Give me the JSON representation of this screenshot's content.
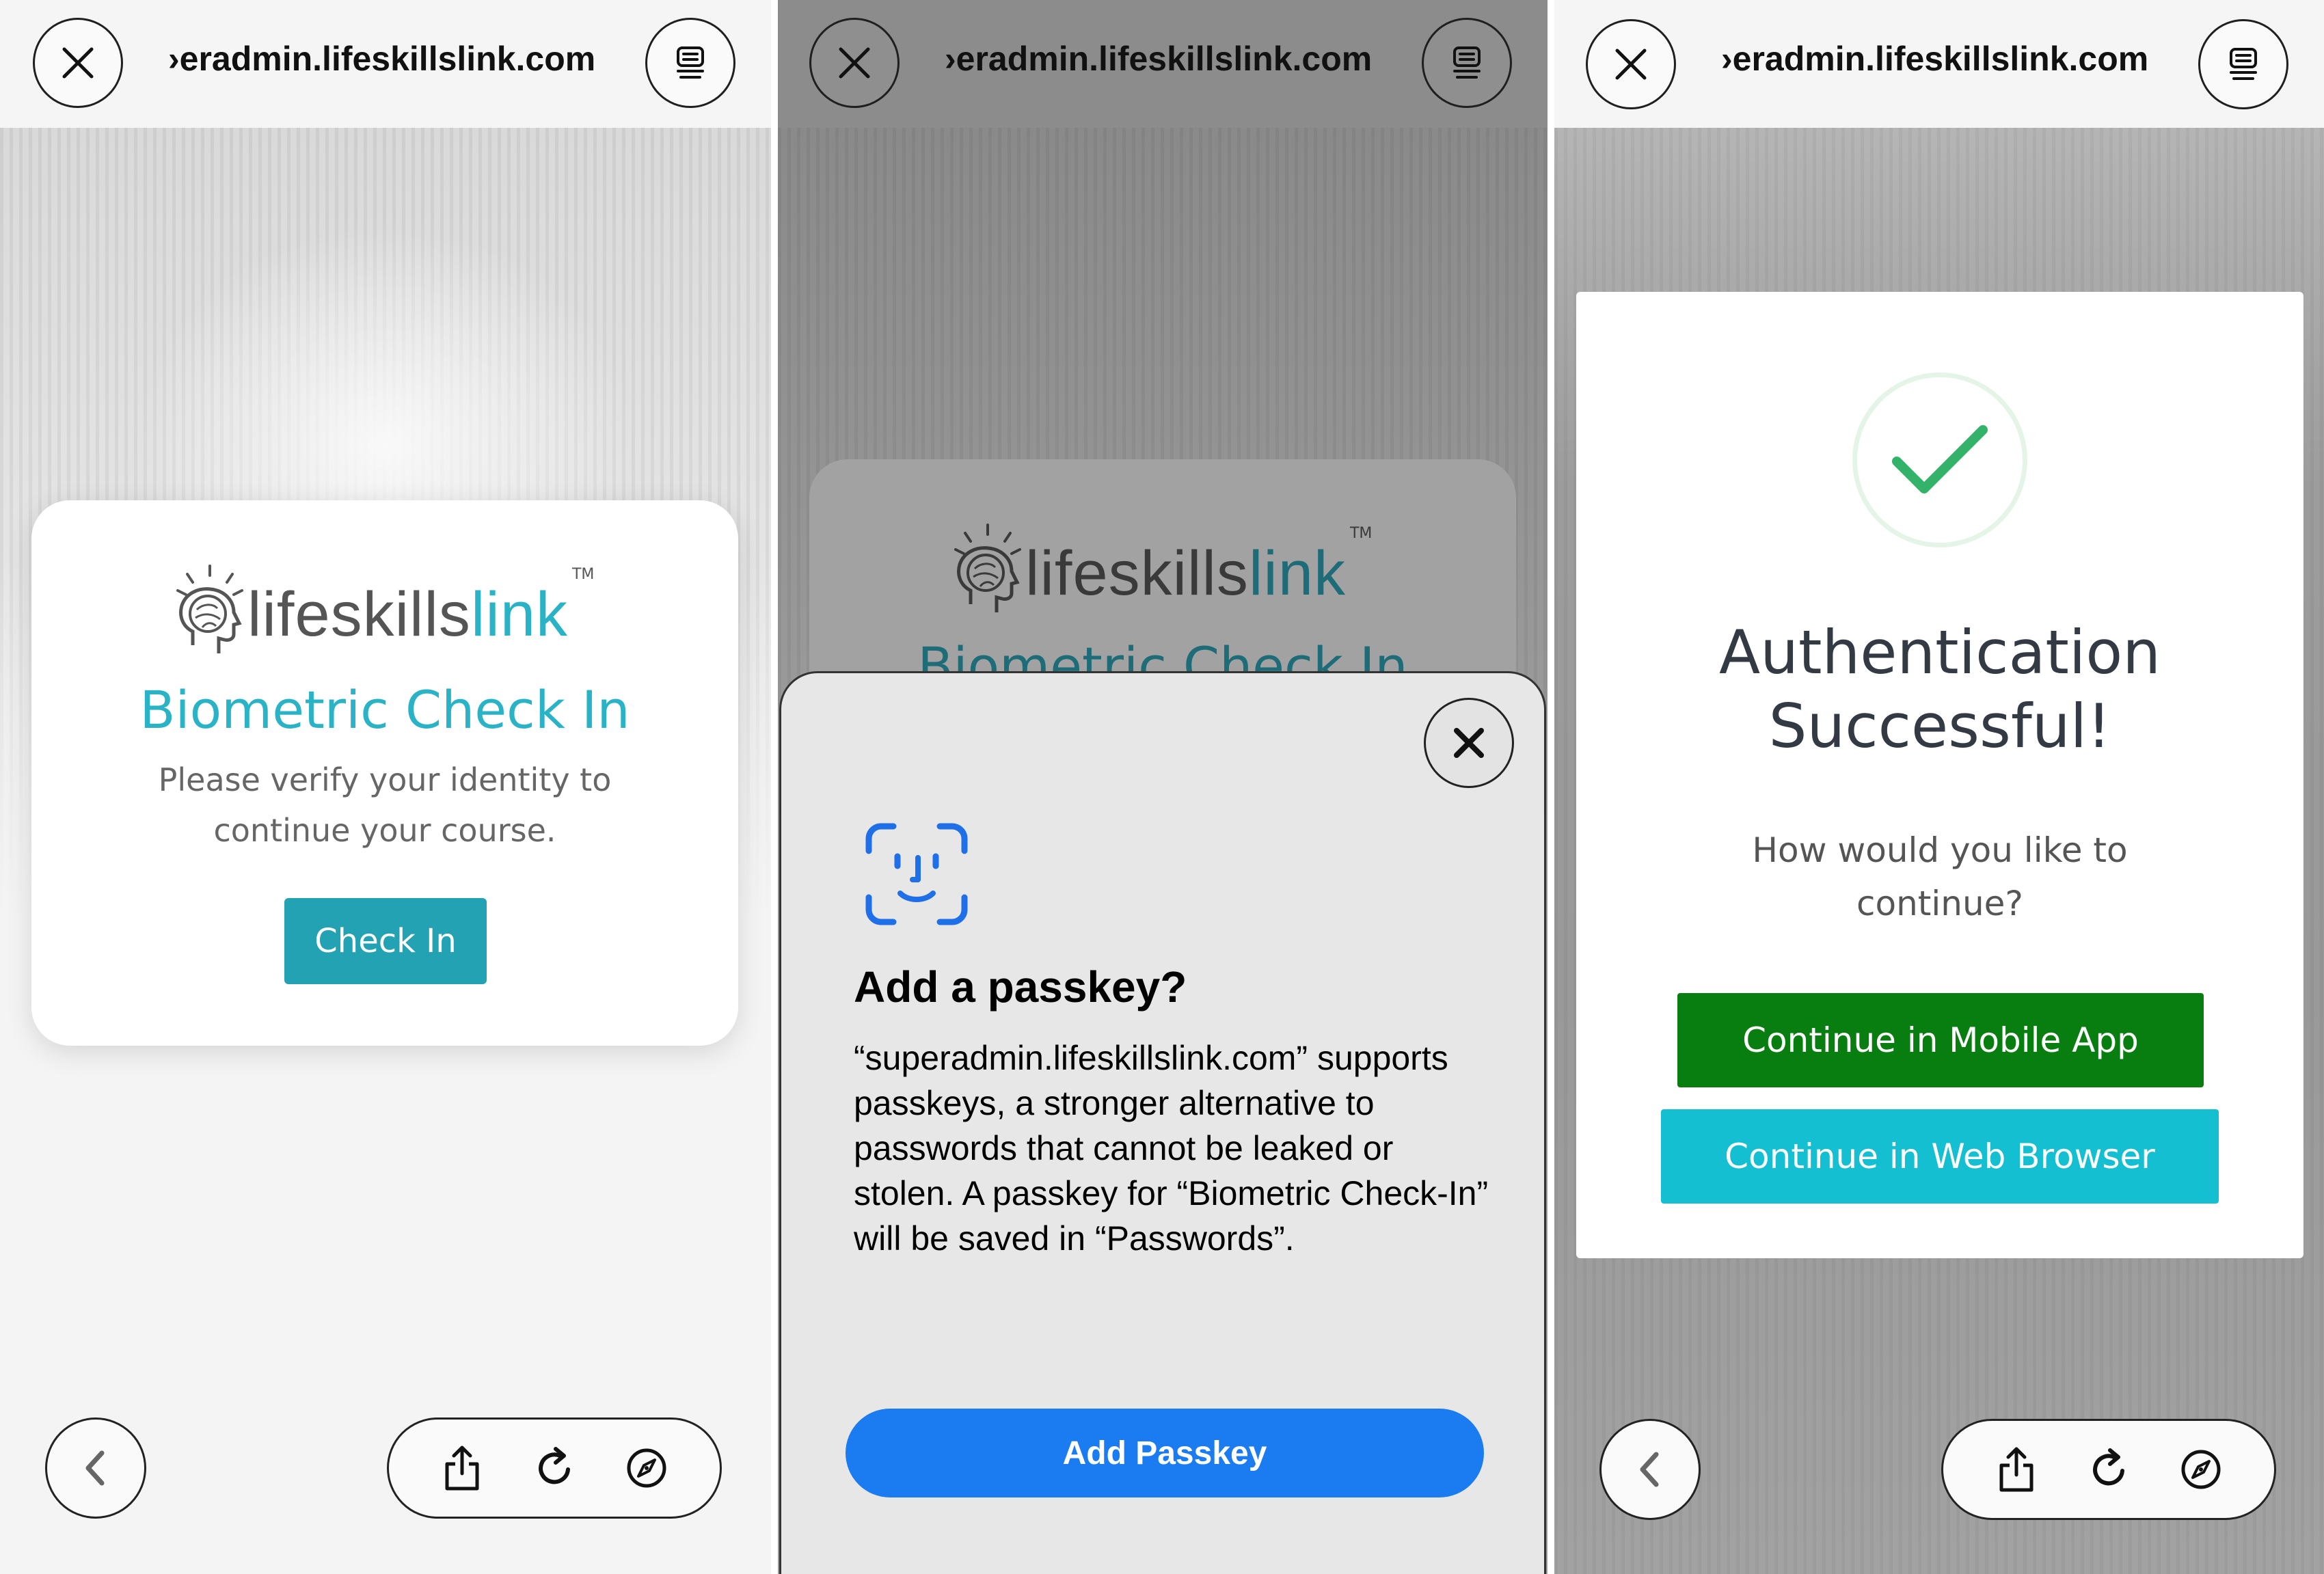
{
  "browser": {
    "url": "›eradmin.lifeskillslink.com"
  },
  "logo": {
    "text_main": "lifeskills",
    "text_accent": "link",
    "trademark": "TM"
  },
  "panel1": {
    "title": "Biometric Check In",
    "subtitle": "Please verify your identity to continue your course.",
    "button": "Check In"
  },
  "panel2": {
    "background_title": "Biometric Check In",
    "sheet": {
      "title": "Add a passkey?",
      "body": "“superadmin.lifeskillslink.com” supports passkeys, a stronger alternative to passwords that cannot be leaked or stolen. A passkey for “Biometric Check-In” will be saved in “Passwords”.",
      "button": "Add Passkey"
    }
  },
  "panel3": {
    "title_line1": "Authentication",
    "title_line2": "Successful!",
    "subtitle": "How would you like to continue?",
    "button_mobile": "Continue in Mobile App",
    "button_web": "Continue in Web Browser"
  },
  "icons": [
    "close-icon",
    "reader-icon",
    "chevron-left-icon",
    "share-icon",
    "reload-icon",
    "compass-icon",
    "face-id-icon",
    "checkmark-icon",
    "brain-head-icon"
  ],
  "colors": {
    "accent": "#2ab3c6",
    "check_in_button": "#22a2b3",
    "passkey_blue": "#1a7cf0",
    "mobile_green": "#097e10",
    "web_cyan": "#13bfd0"
  }
}
